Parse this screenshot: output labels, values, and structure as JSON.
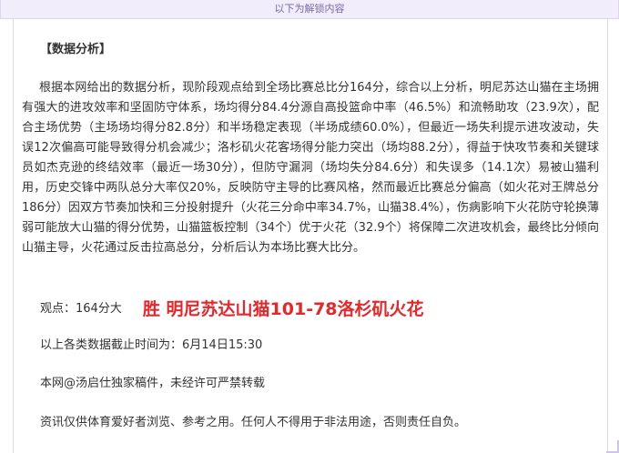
{
  "unlock_banner": "以下为解锁内容",
  "section_title": "【数据分析】",
  "analysis_text": "根据本网给出的数据分析，现阶段观点给到全场比赛总比分164分，综合以上分析，明尼苏达山猫在主场拥有强大的进攻效率和坚固防守体系，场均得分84.4分源自高投篮命中率（46.5%）和流畅助攻（23.9次），配合主场优势（主场场均得分82.8分）和半场稳定表现（半场成绩60.0%），但最近一场失利提示进攻波动，失误12次偏高可能导致得分机会减少；洛杉矶火花客场得分能力突出（场均88.2分），得益于快攻节奏和关键球员如杰克逊的终结效率（最近一场30分），但防守漏洞（场均失分84.6分）和失误多（14.1次）易被山猫利用，历史交锋中两队总分大率仅20%，反映防守主导的比赛风格，然而最近比赛总分偏高（如火花对王牌总分186分）因双方节奏加快和三分投射提升（火花三分命中率34.7%，山猫38.4%），伤病影响下火花防守轮换薄弱可能放大山猫的得分优势，山猫篮板控制（34个）优于火花（32.9个）将保障二次进攻机会，最终比分倾向山猫主导，火花通过反击拉高总分，分析后认为本场比赛大比分。",
  "verdict": {
    "label": "观点：164分大",
    "result": "胜  明尼苏达山猫101-78洛杉矶火花"
  },
  "deadline_text": "以上各类数据截止时间为：6月14日15:30",
  "copyright_text": "本网@汤启仕独家稿件，未经许可严禁转载",
  "disclaimer_text": "资讯仅供体育爱好者浏览、参考之用。任何人不得用于非法用途，否则责任自负。",
  "colors": {
    "accent_red": "#e8262a",
    "banner_bg": "#f1edfa",
    "banner_text": "#7b6aa8",
    "body_text": "#333333"
  }
}
